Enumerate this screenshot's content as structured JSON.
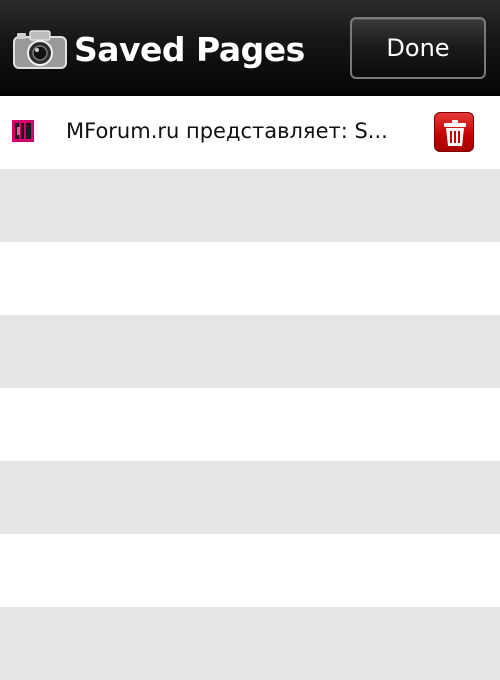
{
  "header": {
    "title": "Saved Pages",
    "done_label": "Done",
    "icon": "camera-icon"
  },
  "saved_pages": [
    {
      "title": "MForum.ru представляет: S...",
      "favicon": "mforum-favicon-icon",
      "delete_icon": "trash-icon"
    }
  ],
  "colors": {
    "header_bg": "#111111",
    "row_alt": "#e5e5e5",
    "delete_red": "#c40000"
  }
}
